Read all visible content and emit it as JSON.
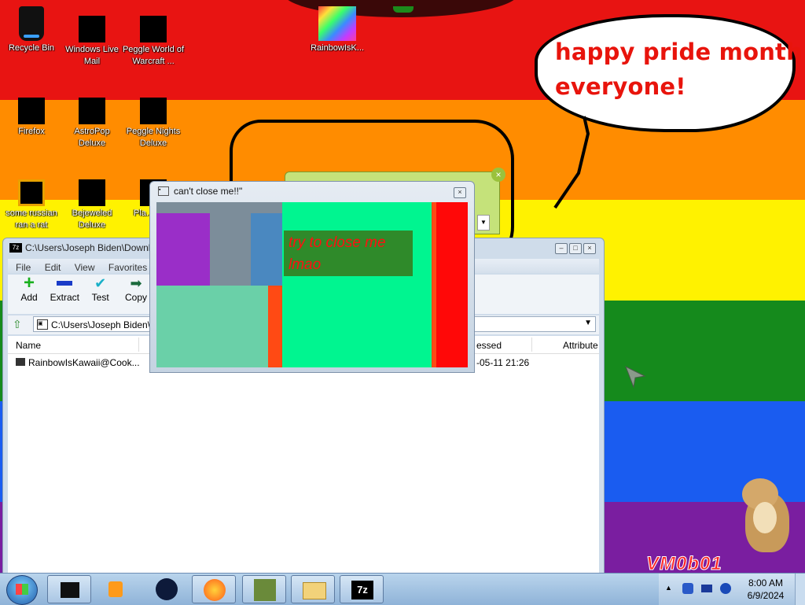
{
  "desktop": {
    "icons": [
      {
        "label": "Recycle Bin"
      },
      {
        "label": "Windows Live Mail"
      },
      {
        "label": "Peggle World of Warcraft ..."
      },
      {
        "label": "RainbowIsK..."
      },
      {
        "label": "Firefox"
      },
      {
        "label": "AstroPop Deluxe"
      },
      {
        "label": "Peggle Nights Deluxe"
      },
      {
        "label": "some russian ran a rat"
      },
      {
        "label": "Bejeweled Deluxe"
      },
      {
        "label": "Pla... Zo..."
      }
    ],
    "speech_bubble": {
      "line1": "happy pride month",
      "line2": "everyone!"
    },
    "watermark": "VM0b01",
    "stripe_colors": [
      "#e81412",
      "#ff8c00",
      "#fff200",
      "#158a1c",
      "#1a5cf0",
      "#7a1ea0"
    ]
  },
  "popup": {
    "title": "can't close me!!\"",
    "message_line1": "try to close me",
    "message_line2": "lmao"
  },
  "sevenzip": {
    "title": "C:\\Users\\Joseph Biden\\Downl",
    "menu": [
      "File",
      "Edit",
      "View",
      "Favorites",
      "T"
    ],
    "toolbar": [
      "Add",
      "Extract",
      "Test",
      "Copy",
      "M"
    ],
    "address": "C:\\Users\\Joseph Biden\\",
    "columns": {
      "name": "Name",
      "accessed": "essed",
      "attributes": "Attribute"
    },
    "rows": [
      {
        "name": "RainbowIsKawaii@Cook...",
        "accessed": "-05-11 21:26"
      }
    ]
  },
  "taskbar": {
    "time": "8:00 AM",
    "date": "6/9/2024"
  }
}
